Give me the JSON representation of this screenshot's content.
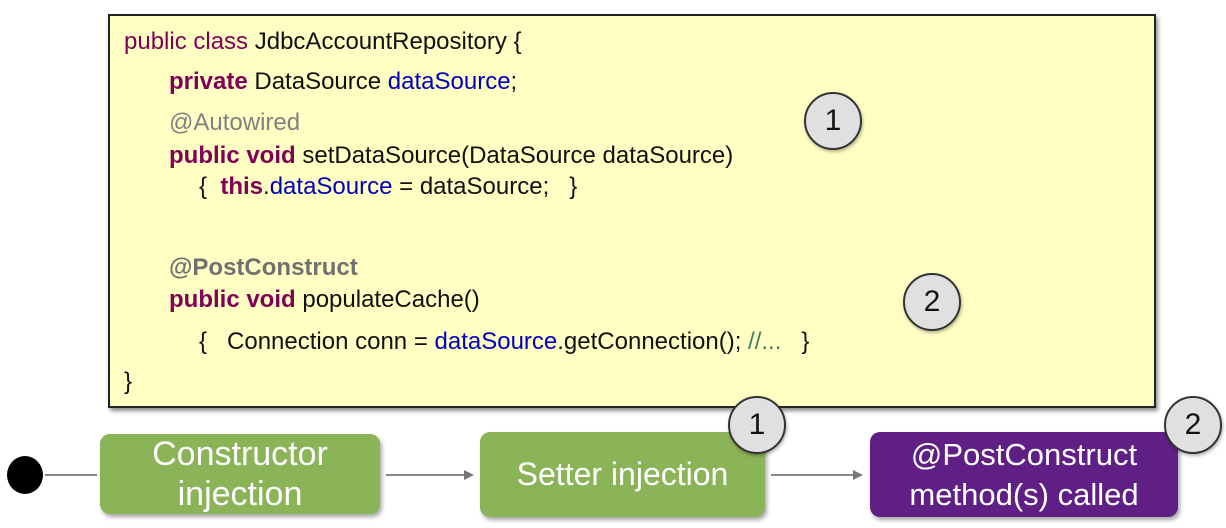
{
  "code": {
    "lines": [
      {
        "tokens": [
          {
            "t": "kw",
            "text": "public class "
          },
          {
            "t": "",
            "text": "JdbcAccountRepository {"
          }
        ]
      },
      {
        "tokens": [
          {
            "t": "kwb",
            "text": "private "
          },
          {
            "t": "",
            "text": "DataSource "
          },
          {
            "t": "fld",
            "text": "dataSource"
          },
          {
            "t": "",
            "text": ";"
          }
        ]
      },
      {
        "tokens": [
          {
            "t": "ann",
            "text": "@Autowired"
          }
        ]
      },
      {
        "tokens": [
          {
            "t": "kwb",
            "text": "public void "
          },
          {
            "t": "",
            "text": "setDataSource(DataSource dataSource)"
          }
        ]
      },
      {
        "tokens": [
          {
            "t": "",
            "text": "{  "
          },
          {
            "t": "kwb",
            "text": "this"
          },
          {
            "t": "",
            "text": "."
          },
          {
            "t": "fld",
            "text": "dataSource"
          },
          {
            "t": "",
            "text": " = dataSource;   }"
          }
        ]
      },
      {
        "tokens": [
          {
            "t": "annb",
            "text": "@PostConstruct"
          }
        ]
      },
      {
        "tokens": [
          {
            "t": "kwb",
            "text": "public void "
          },
          {
            "t": "",
            "text": "populateCache()"
          }
        ]
      },
      {
        "tokens": [
          {
            "t": "",
            "text": "{   Connection conn = "
          },
          {
            "t": "fld",
            "text": "dataSource"
          },
          {
            "t": "",
            "text": ".getConnection(); "
          },
          {
            "t": "cmt",
            "text": "//..."
          },
          {
            "t": "",
            "text": "   }"
          }
        ]
      },
      {
        "tokens": [
          {
            "t": "",
            "text": "}"
          }
        ]
      }
    ]
  },
  "markers": {
    "one": "1",
    "two": "2"
  },
  "flow": {
    "step1": {
      "line1": "Constructor",
      "line2": "injection"
    },
    "step2": {
      "label": "Setter injection"
    },
    "step3": {
      "line1": "@PostConstruct",
      "line2": "method(s) called"
    }
  },
  "colors": {
    "keyword": "#7f0055",
    "field": "#0000c0",
    "green_box": "#8bb357",
    "purple_box": "#5f1f84",
    "code_background": "#ffffc4"
  }
}
